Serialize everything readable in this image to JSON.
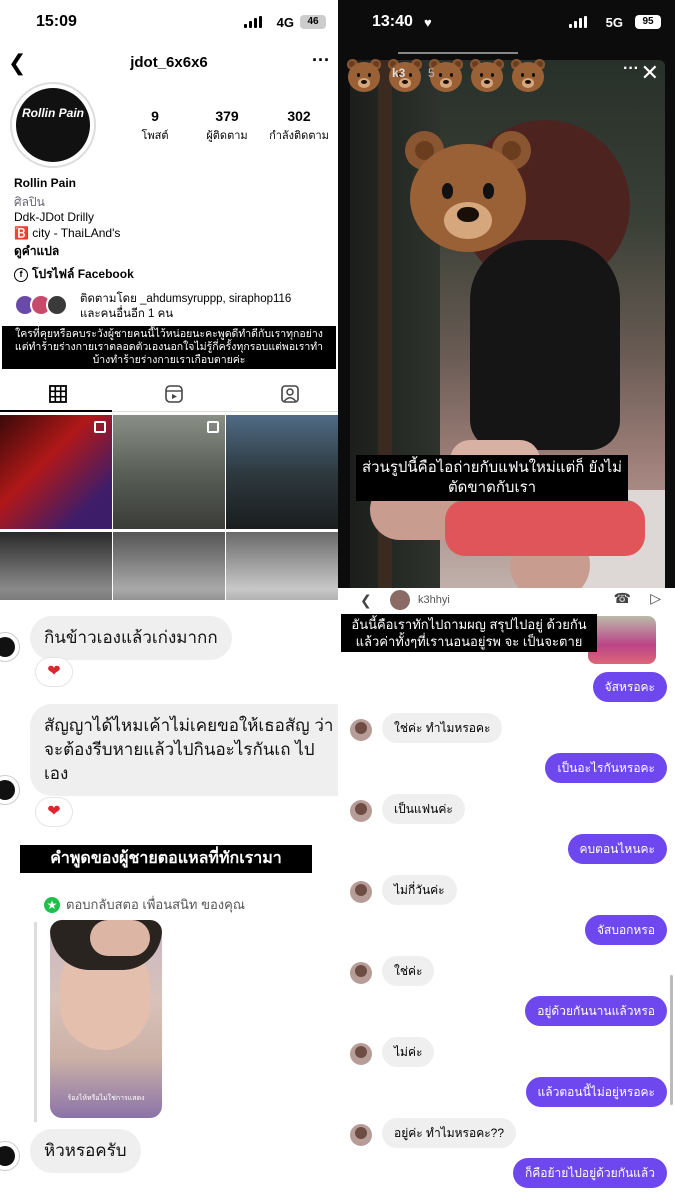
{
  "q1": {
    "status": {
      "time": "15:09",
      "network": "4G",
      "battery": "46"
    },
    "username": "jdot_6x6x6",
    "avatar_text": "Rollin Pain",
    "stats": [
      {
        "num": "9",
        "label": "โพสต์"
      },
      {
        "num": "379",
        "label": "ผู้ติดตาม"
      },
      {
        "num": "302",
        "label": "กำลังติดตาม"
      }
    ],
    "name": "Rollin Pain",
    "category": "ศิลปิน",
    "bio1": "Ddk-JDot Drilly",
    "bio2": "🅱️ city - ThaiLAnd's",
    "translate": "ดูคำแปล",
    "facebook": "โปรไฟล์ Facebook",
    "mutual": "ติดตามโดย _ahdumsyruppp, siraphop116",
    "mutual2": "และคนอื่นอีก 1 คน",
    "caption": "ใครที่คุยหรือคบระวังผู้ชายคนนี้ไว้หน่อยนะคะพูดดีทำดีกับเราทุกอย่าง แต่ทำร้ายร่างกายเราตลอดตัวเองนอกใจไม่รู้กี่ครั้งทุกรอบแต่พอเราทำ บ้างทำร้ายร่างกายเราเกือบตายค่ะ"
  },
  "q2": {
    "status": {
      "time": "13:40",
      "network": "5G",
      "battery": "95"
    },
    "story_user": "k3",
    "story_time": "5",
    "caption": "ส่วนรูปนี้คือไอถ่ายกับแฟนใหม่แต่ก็ ยังไม่ตัดขาดกับเรา"
  },
  "q3": {
    "msg1": "กินข้าวเองแล้วเก่งมากก",
    "msg2": "สัญญาได้ไหมเค้าไม่เคยขอให้เธอสัญ ว่าจะต้องรีบหายแล้วไปกินอะไรกันเถ ไปเอง",
    "caption": "คำพูดของผู้ชายตอแหลที่ทักเรามา",
    "reply_label": "ตอบกลับสตอ เพื่อนสนิท ของคุณ",
    "reply_img_caption": "ร้องไห้หรือไม่ใช่การแสดง",
    "msg3": "หิวหรอครับ",
    "heart": "❤"
  },
  "q4": {
    "header_user": "k3hhyi",
    "caption": "อันนี้คือเราทักไปถามผญ สรุปไปอยู่ ด้วยกันแล้วค่าทั้งๆที่เรานอนอยู่รพ จะ เป็นจะตาย",
    "messages": [
      {
        "side": "right",
        "text": "จัสหรอคะ"
      },
      {
        "side": "left",
        "text": "ใช่ค่ะ ทำไมหรอคะ"
      },
      {
        "side": "right",
        "text": "เป็นอะไรกันหรอคะ"
      },
      {
        "side": "left",
        "text": "เป็นแฟนค่ะ"
      },
      {
        "side": "right",
        "text": "คบตอนไหนคะ"
      },
      {
        "side": "left",
        "text": "ไม่กี่วันค่ะ"
      },
      {
        "side": "right",
        "text": "จัสบอกหรอ"
      },
      {
        "side": "left",
        "text": "ใช่ค่ะ"
      },
      {
        "side": "right",
        "text": "อยู่ด้วยกันนานแล้วหรอ"
      },
      {
        "side": "left",
        "text": "ไม่ค่ะ"
      },
      {
        "side": "right",
        "text": "แล้วตอนนี้ไม่อยู่หรอคะ"
      },
      {
        "side": "left",
        "text": "อยู่ค่ะ ทำไมหรอคะ??"
      },
      {
        "side": "right",
        "text": "ก็คือย้ายไปอยู่ด้วยกันแล้ว"
      }
    ]
  },
  "colors": {
    "ig_blue": "#2a7de1",
    "bubble_purple": "#6f47ef",
    "bubble_gray": "#efefef",
    "heart": "#e0242f"
  }
}
